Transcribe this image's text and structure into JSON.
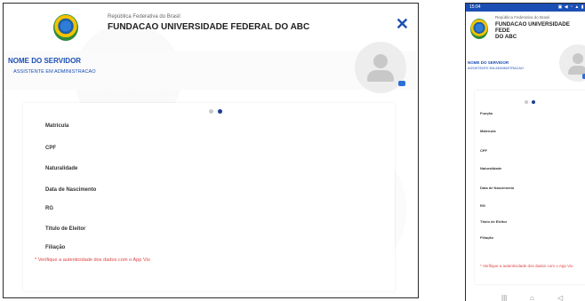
{
  "header": {
    "gov_line": "República Federativa do Brasil",
    "institution": "FUNDACAO UNIVERSIDADE FEDERAL DO ABC",
    "institution_wrapped": "FUNDACAO UNIVERSIDADE FEDE\nDO ABC",
    "close_symbol": "✕"
  },
  "profile": {
    "name": "NOME DO SERVIDOR",
    "role": "ASSISTENTE EM ADMINISTRACAO"
  },
  "carousel": {
    "count": 2,
    "active_index": 1
  },
  "fields_desktop": [
    "Matrícula",
    "CPF",
    "Naturalidade",
    "Data de Nascimento",
    "RG",
    "Título de Eleitor",
    "Filiação"
  ],
  "fields_mobile": [
    "Função",
    "Matrícula",
    "CPF",
    "Naturalidade",
    "Data de Nascimento",
    "RG",
    "Título de Eleitor",
    "Filiação"
  ],
  "note": "* Verifique a autenticidade dos dados com o App Vio",
  "mobile": {
    "status_time": "15:04",
    "status_icons": "▣ ◀ ◔ ▲ ▮",
    "nav_icons": [
      "|||",
      "⌂",
      "◁"
    ]
  },
  "colors": {
    "brand_blue": "#1b4fb4",
    "note_red": "#e04444",
    "dot_active": "#1b3e93",
    "dot_inactive": "#c9c9c9"
  },
  "icons": {
    "close": "close-icon",
    "avatar": "person-avatar-icon",
    "camera": "camera-icon",
    "emblem": "brazil-coat-of-arms-icon"
  }
}
